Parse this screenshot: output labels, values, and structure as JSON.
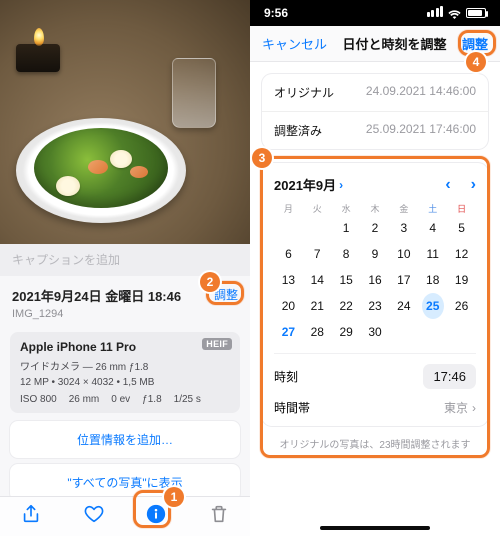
{
  "left": {
    "caption_placeholder": "キャプションを追加",
    "date_line": "2021年9月24日 金曜日 18:46",
    "image_id": "IMG_1294",
    "adjust_label": "調整",
    "device": "Apple iPhone 11 Pro",
    "heif_badge": "HEIF",
    "lens_line": "ワイドカメラ — 26 mm ƒ1.8",
    "res_line_mp": "12 MP",
    "res_line_dim": "3024 × 4032",
    "res_line_size": "1,5 MB",
    "exif_iso": "ISO 800",
    "exif_fl": "26 mm",
    "exif_ev": "0 ev",
    "exif_ap": "ƒ1.8",
    "exif_sh": "1/25 s",
    "add_location": "位置情報を追加…",
    "in_all_photos": "\"すべての写真\"に表示"
  },
  "right": {
    "status_time": "9:56",
    "cancel": "キャンセル",
    "title": "日付と時刻を調整",
    "done": "調整",
    "original_k": "オリジナル",
    "original_v": "24.09.2021 14:46:00",
    "adjusted_k": "調整済み",
    "adjusted_v": "25.09.2021 17:46:00",
    "month_label": "2021年9月",
    "dow": [
      "月",
      "火",
      "水",
      "木",
      "金",
      "土",
      "日"
    ],
    "weeks": [
      [
        "",
        "",
        "1",
        "2",
        "3",
        "4",
        "5"
      ],
      [
        "6",
        "7",
        "8",
        "9",
        "10",
        "11",
        "12"
      ],
      [
        "13",
        "14",
        "15",
        "16",
        "17",
        "18",
        "19"
      ],
      [
        "20",
        "21",
        "22",
        "23",
        "24",
        "25",
        "26"
      ],
      [
        "27",
        "28",
        "29",
        "30",
        "",
        "",
        ""
      ]
    ],
    "selected_day": "25",
    "blue_day": "27",
    "time_label": "時刻",
    "time_value": "17:46",
    "tz_label": "時間帯",
    "tz_value": "東京",
    "note": "オリジナルの写真は、23時間調整されます"
  },
  "badges": {
    "b1": "1",
    "b2": "2",
    "b3": "3",
    "b4": "4"
  }
}
